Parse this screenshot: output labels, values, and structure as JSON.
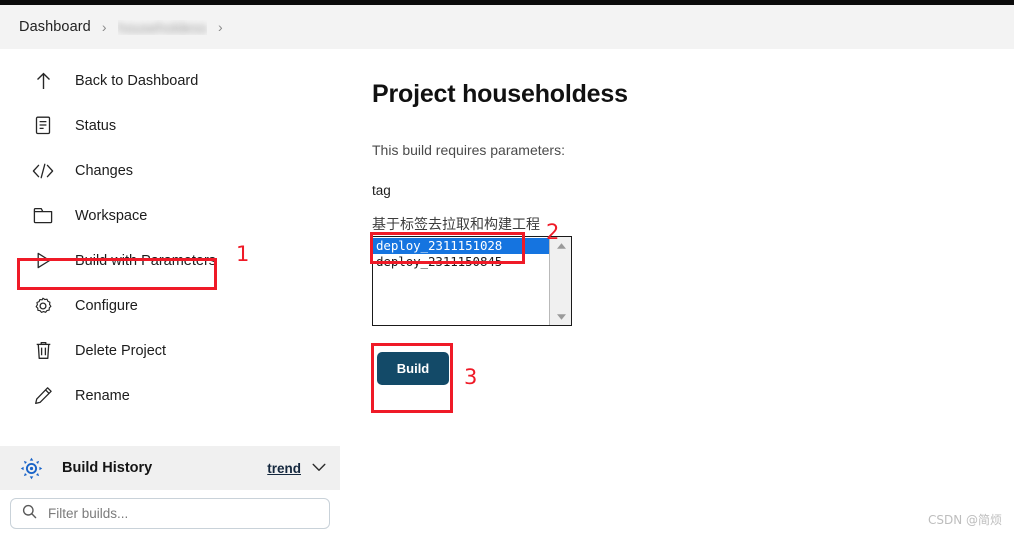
{
  "breadcrumb": {
    "items": [
      {
        "label": "Dashboard",
        "redacted": false
      },
      {
        "label": "householdess",
        "redacted": true
      }
    ],
    "separator": "›"
  },
  "sidebar": {
    "items": [
      {
        "label": "Back to Dashboard",
        "icon": "arrow-up-icon"
      },
      {
        "label": "Status",
        "icon": "document-icon"
      },
      {
        "label": "Changes",
        "icon": "code-brackets-icon"
      },
      {
        "label": "Workspace",
        "icon": "folder-icon"
      },
      {
        "label": "Build with Parameters",
        "icon": "play-triangle-icon"
      },
      {
        "label": "Configure",
        "icon": "gear-icon"
      },
      {
        "label": "Delete Project",
        "icon": "trash-icon"
      },
      {
        "label": "Rename",
        "icon": "pencil-icon"
      }
    ],
    "build_history": {
      "title": "Build History",
      "icon": "jenkins-weather-icon",
      "trend_label": "trend",
      "chevron": "chevron-down-icon"
    },
    "filter": {
      "placeholder": "Filter builds...",
      "value": "",
      "icon": "search-icon"
    }
  },
  "main": {
    "title": "Project householdess",
    "requires_text": "This build requires parameters:",
    "parameter": {
      "name": "tag",
      "description": "基于标签去拉取和构建工程",
      "options": [
        {
          "value": "deploy_2311151028",
          "selected": true
        },
        {
          "value": "deploy_2311150845",
          "selected": false
        }
      ]
    },
    "build_button_label": "Build"
  },
  "annotations": [
    {
      "number": "1",
      "target": "build-with-parameters-nav-item"
    },
    {
      "number": "2",
      "target": "tag-parameter-listbox"
    },
    {
      "number": "3",
      "target": "build-button"
    }
  ],
  "watermark": "CSDN @简烦",
  "colors": {
    "accent_blue": "#1574e0",
    "button_navy": "#134a68",
    "annotation_red": "#ef1a27",
    "bar_gray": "#f3f3f3",
    "panel_gray": "#f0f0f0"
  }
}
